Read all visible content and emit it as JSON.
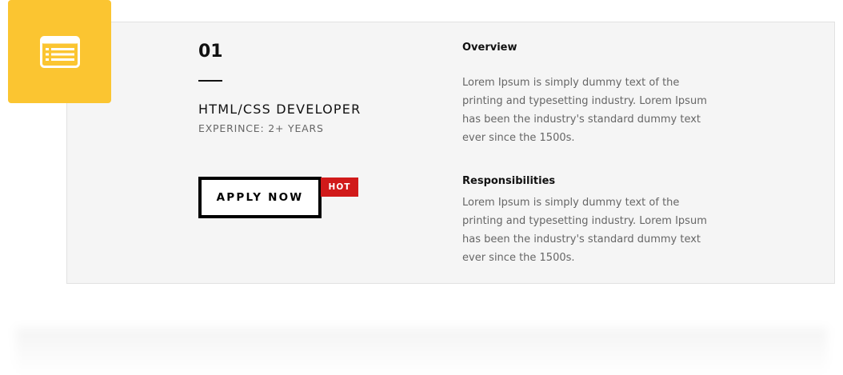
{
  "job": {
    "number": "01",
    "title": "HTML/CSS DEVELOPER",
    "experience": "EXPERINCE: 2+ YEARS",
    "apply_label": "APPLY NOW",
    "badge": "HOT"
  },
  "overview": {
    "heading": "Overview",
    "text": "Lorem Ipsum is simply dummy text of the printing and typesetting industry. Lorem Ipsum has been the industry's standard dummy text ever since the 1500s."
  },
  "responsibilities": {
    "heading": "Responsibilities",
    "text": "Lorem Ipsum is simply dummy text of the printing and typesetting industry. Lorem Ipsum has been the industry's standard dummy text ever since the 1500s."
  },
  "icon": "list-icon",
  "colors": {
    "accent": "#fbc531",
    "badge": "#d11a1a",
    "card_background": "#f5f5f5"
  }
}
